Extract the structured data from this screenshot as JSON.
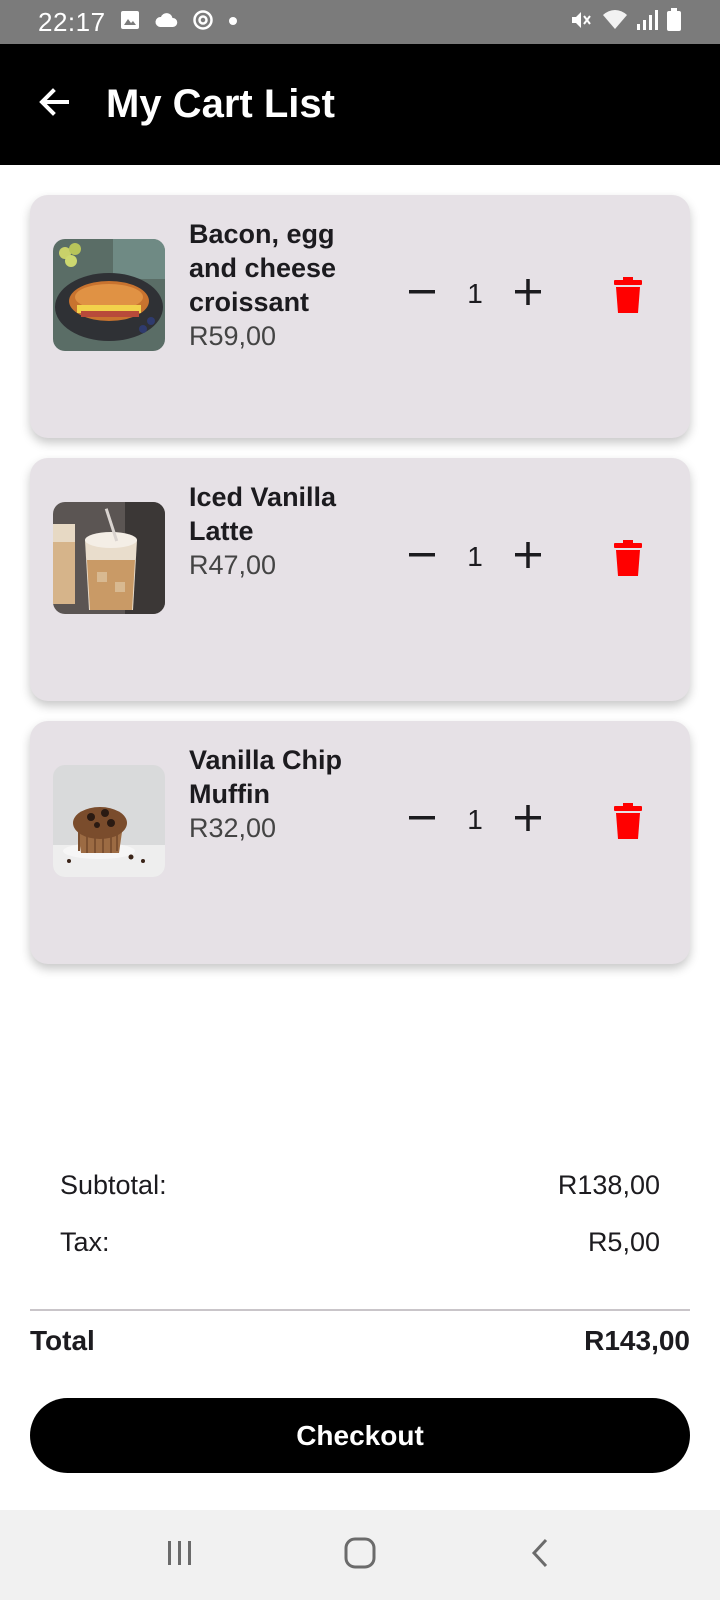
{
  "status_bar": {
    "time": "22:17",
    "icons_left": [
      "image-icon",
      "cloud-icon",
      "sync-icon",
      "dot-icon"
    ],
    "icons_right": [
      "mute-icon",
      "wifi-icon",
      "signal-icon",
      "battery-icon"
    ]
  },
  "header": {
    "title": "My Cart List",
    "back_icon": "arrow-left-icon"
  },
  "cart": {
    "items": [
      {
        "name": "Bacon, egg and cheese croissant",
        "price": "R59,00",
        "quantity": "1",
        "image": "croissant"
      },
      {
        "name": "Iced Vanilla Latte",
        "price": "R47,00",
        "quantity": "1",
        "image": "iced-latte"
      },
      {
        "name": "Vanilla Chip Muffin",
        "price": "R32,00",
        "quantity": "1",
        "image": "muffin"
      }
    ]
  },
  "summary": {
    "subtotal_label": "Subtotal:",
    "subtotal_value": "R138,00",
    "tax_label": "Tax:",
    "tax_value": "R5,00",
    "total_label": "Total",
    "total_value": "R143,00"
  },
  "checkout": {
    "label": "Checkout"
  },
  "colors": {
    "app_bar": "#000000",
    "card_bg": "#e6e1e6",
    "delete": "#ff0000",
    "checkout_bg": "#000000",
    "status_bar": "#7b7b7b"
  },
  "nav_bar": {
    "icons": [
      "recent-apps-icon",
      "home-icon",
      "back-nav-icon"
    ]
  }
}
